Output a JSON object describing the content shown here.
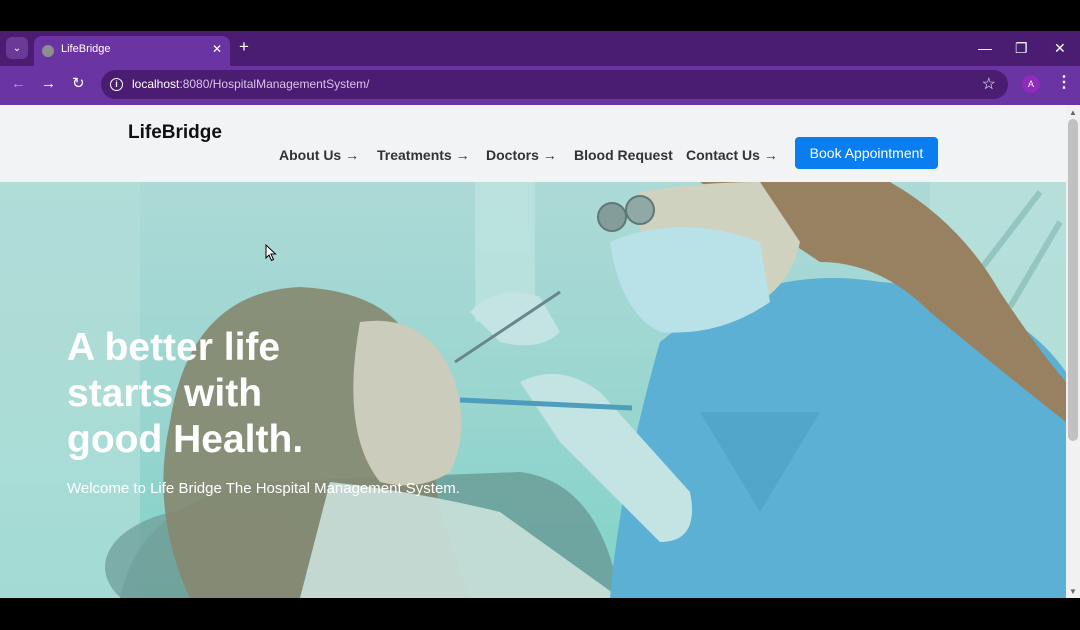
{
  "browser": {
    "tab_title": "LifeBridge",
    "tab_close": "✕",
    "new_tab": "+",
    "url_host": "localhost",
    "url_path": ":8080/HospitalManagementSystem/",
    "profile_initial": "A",
    "window_controls": {
      "minimize": "—",
      "maximize": "❐",
      "close": "✕"
    },
    "back": "←",
    "forward": "→",
    "reload": "↻",
    "star": "☆",
    "menu": "⋮",
    "tab_menu": "⌄"
  },
  "site": {
    "logo": "LifeBridge",
    "nav": [
      {
        "label": "About Us →"
      },
      {
        "label": "Treatments →"
      },
      {
        "label": "Doctors →"
      },
      {
        "label": "Blood Request"
      },
      {
        "label": "Contact Us →"
      }
    ],
    "cta": "Book Appointment",
    "hero": {
      "title_lines": [
        "A better life",
        "starts with",
        "good Health."
      ],
      "subtitle": "Welcome to Life Bridge The Hospital Management System."
    }
  },
  "colors": {
    "browser_frame": "#4a1d73",
    "toolbar": "#6b34a3",
    "cta": "#0a7ef0",
    "hero_tint": "#7fd3c9"
  }
}
